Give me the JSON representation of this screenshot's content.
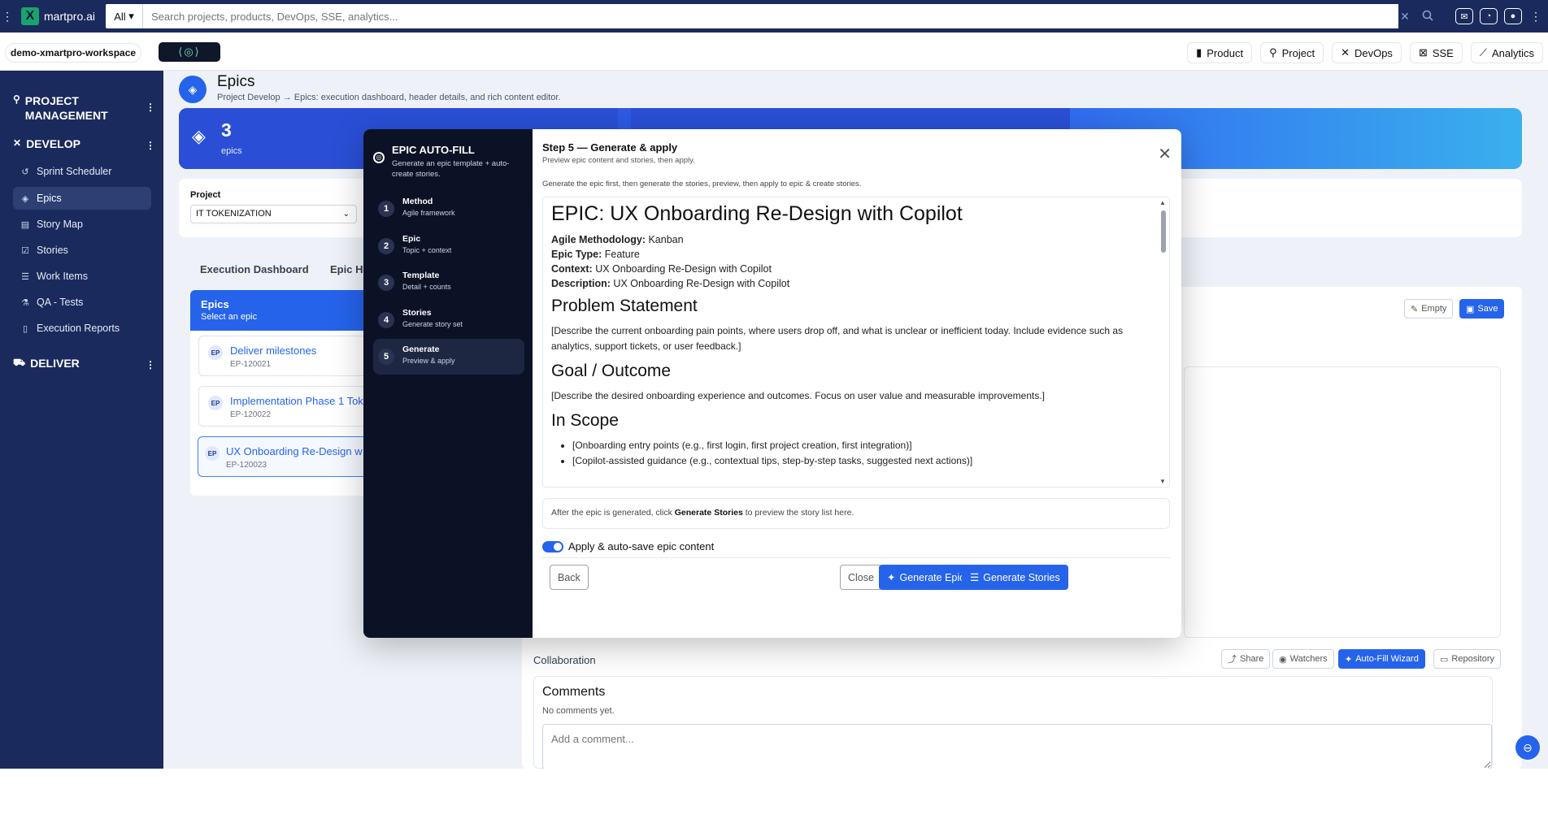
{
  "topbar": {
    "brand": "martpro.ai",
    "scope": "All",
    "search_placeholder": "Search projects, products, DevOps, SSE, analytics..."
  },
  "workspace": {
    "name": "demo-xmartpro-workspace",
    "nav": [
      "Product",
      "Project",
      "DevOps",
      "SSE",
      "Analytics"
    ]
  },
  "sidebar": {
    "sections": [
      {
        "label": "PROJECT MANAGEMENT"
      },
      {
        "label": "DEVELOP"
      },
      {
        "label": "DELIVER"
      }
    ],
    "items": [
      {
        "label": "Sprint Scheduler"
      },
      {
        "label": "Epics"
      },
      {
        "label": "Story Map"
      },
      {
        "label": "Stories"
      },
      {
        "label": "Work Items"
      },
      {
        "label": "QA - Tests"
      },
      {
        "label": "Execution Reports"
      }
    ]
  },
  "page": {
    "title": "Epics",
    "subtitle": "Project Develop → Epics: execution dashboard, header details, and rich content editor."
  },
  "stats": {
    "epics_value": "3",
    "epics_label": "epics"
  },
  "project": {
    "label": "Project",
    "selected": "IT TOKENIZATION"
  },
  "tabs": [
    "Execution Dashboard",
    "Epic He"
  ],
  "epic_list": {
    "title": "Epics",
    "subtitle": "Select an epic",
    "items": [
      {
        "badge": "EP",
        "name": "Deliver milestones",
        "id": "EP-120021"
      },
      {
        "badge": "EP",
        "name": "Implementation Phase 1 Tok",
        "id": "EP-120022"
      },
      {
        "badge": "EP",
        "name": "UX Onboarding Re-Design w",
        "id": "EP-120023"
      }
    ]
  },
  "editor_actions": {
    "empty": "Empty",
    "save": "Save"
  },
  "collaboration": {
    "label": "Collaboration",
    "share": "Share",
    "watchers": "Watchers",
    "autofill": "Auto-Fill Wizard",
    "repository": "Repository",
    "comments_title": "Comments",
    "no_comments": "No comments yet.",
    "comment_placeholder": "Add a comment..."
  },
  "wizard": {
    "title": "EPIC AUTO-FILL",
    "subtitle": "Generate an epic template + auto-create stories.",
    "steps": [
      {
        "num": "1",
        "title": "Method",
        "sub": "Agile framework"
      },
      {
        "num": "2",
        "title": "Epic",
        "sub": "Topic + context"
      },
      {
        "num": "3",
        "title": "Template",
        "sub": "Detail + counts"
      },
      {
        "num": "4",
        "title": "Stories",
        "sub": "Generate story set"
      },
      {
        "num": "5",
        "title": "Generate",
        "sub": "Preview & apply"
      }
    ],
    "step_title": "Step 5 — Generate & apply",
    "step_sub": "Preview epic content and stories, then apply.",
    "info": "Generate the epic first, then generate the stories, preview, then apply to epic & create stories.",
    "preview": {
      "heading": "EPIC: UX Onboarding Re-Design with Copilot",
      "fields": [
        {
          "k": "Agile Methodology:",
          "v": "Kanban"
        },
        {
          "k": "Epic Type:",
          "v": "Feature"
        },
        {
          "k": "Context:",
          "v": "UX Onboarding Re-Design with Copilot"
        },
        {
          "k": "Description:",
          "v": "UX Onboarding Re-Design with Copilot"
        }
      ],
      "problem_h": "Problem Statement",
      "problem_p": "[Describe the current onboarding pain points, where users drop off, and what is unclear or inefficient today. Include evidence such as analytics, support tickets, or user feedback.]",
      "goal_h": "Goal / Outcome",
      "goal_p": "[Describe the desired onboarding experience and outcomes. Focus on user value and measurable improvements.]",
      "scope_h": "In Scope",
      "scope_items": [
        "[Onboarding entry points (e.g., first login, first project creation, first integration)]",
        "[Copilot-assisted guidance (e.g., contextual tips, step-by-step tasks, suggested next actions)]"
      ]
    },
    "after_pre": "After the epic is generated, click ",
    "after_bold": "Generate Stories",
    "after_post": " to preview the story list here.",
    "toggle_label": "Apply & auto-save epic content",
    "back": "Back",
    "close": "Close",
    "gen_epic": "Generate Epic",
    "gen_stories": "Generate Stories"
  }
}
